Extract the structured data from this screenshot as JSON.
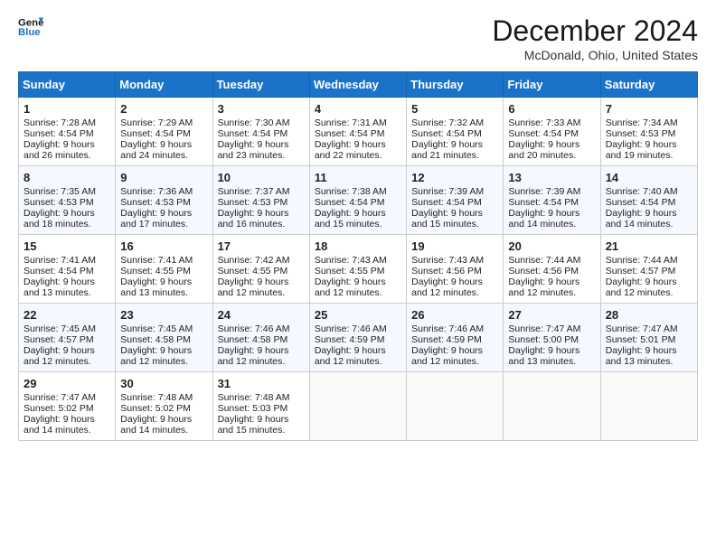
{
  "header": {
    "logo_line1": "General",
    "logo_line2": "Blue",
    "month": "December 2024",
    "location": "McDonald, Ohio, United States"
  },
  "weekdays": [
    "Sunday",
    "Monday",
    "Tuesday",
    "Wednesday",
    "Thursday",
    "Friday",
    "Saturday"
  ],
  "weeks": [
    [
      {
        "day": "1",
        "lines": [
          "Sunrise: 7:28 AM",
          "Sunset: 4:54 PM",
          "Daylight: 9 hours",
          "and 26 minutes."
        ]
      },
      {
        "day": "2",
        "lines": [
          "Sunrise: 7:29 AM",
          "Sunset: 4:54 PM",
          "Daylight: 9 hours",
          "and 24 minutes."
        ]
      },
      {
        "day": "3",
        "lines": [
          "Sunrise: 7:30 AM",
          "Sunset: 4:54 PM",
          "Daylight: 9 hours",
          "and 23 minutes."
        ]
      },
      {
        "day": "4",
        "lines": [
          "Sunrise: 7:31 AM",
          "Sunset: 4:54 PM",
          "Daylight: 9 hours",
          "and 22 minutes."
        ]
      },
      {
        "day": "5",
        "lines": [
          "Sunrise: 7:32 AM",
          "Sunset: 4:54 PM",
          "Daylight: 9 hours",
          "and 21 minutes."
        ]
      },
      {
        "day": "6",
        "lines": [
          "Sunrise: 7:33 AM",
          "Sunset: 4:54 PM",
          "Daylight: 9 hours",
          "and 20 minutes."
        ]
      },
      {
        "day": "7",
        "lines": [
          "Sunrise: 7:34 AM",
          "Sunset: 4:53 PM",
          "Daylight: 9 hours",
          "and 19 minutes."
        ]
      }
    ],
    [
      {
        "day": "8",
        "lines": [
          "Sunrise: 7:35 AM",
          "Sunset: 4:53 PM",
          "Daylight: 9 hours",
          "and 18 minutes."
        ]
      },
      {
        "day": "9",
        "lines": [
          "Sunrise: 7:36 AM",
          "Sunset: 4:53 PM",
          "Daylight: 9 hours",
          "and 17 minutes."
        ]
      },
      {
        "day": "10",
        "lines": [
          "Sunrise: 7:37 AM",
          "Sunset: 4:53 PM",
          "Daylight: 9 hours",
          "and 16 minutes."
        ]
      },
      {
        "day": "11",
        "lines": [
          "Sunrise: 7:38 AM",
          "Sunset: 4:54 PM",
          "Daylight: 9 hours",
          "and 15 minutes."
        ]
      },
      {
        "day": "12",
        "lines": [
          "Sunrise: 7:39 AM",
          "Sunset: 4:54 PM",
          "Daylight: 9 hours",
          "and 15 minutes."
        ]
      },
      {
        "day": "13",
        "lines": [
          "Sunrise: 7:39 AM",
          "Sunset: 4:54 PM",
          "Daylight: 9 hours",
          "and 14 minutes."
        ]
      },
      {
        "day": "14",
        "lines": [
          "Sunrise: 7:40 AM",
          "Sunset: 4:54 PM",
          "Daylight: 9 hours",
          "and 14 minutes."
        ]
      }
    ],
    [
      {
        "day": "15",
        "lines": [
          "Sunrise: 7:41 AM",
          "Sunset: 4:54 PM",
          "Daylight: 9 hours",
          "and 13 minutes."
        ]
      },
      {
        "day": "16",
        "lines": [
          "Sunrise: 7:41 AM",
          "Sunset: 4:55 PM",
          "Daylight: 9 hours",
          "and 13 minutes."
        ]
      },
      {
        "day": "17",
        "lines": [
          "Sunrise: 7:42 AM",
          "Sunset: 4:55 PM",
          "Daylight: 9 hours",
          "and 12 minutes."
        ]
      },
      {
        "day": "18",
        "lines": [
          "Sunrise: 7:43 AM",
          "Sunset: 4:55 PM",
          "Daylight: 9 hours",
          "and 12 minutes."
        ]
      },
      {
        "day": "19",
        "lines": [
          "Sunrise: 7:43 AM",
          "Sunset: 4:56 PM",
          "Daylight: 9 hours",
          "and 12 minutes."
        ]
      },
      {
        "day": "20",
        "lines": [
          "Sunrise: 7:44 AM",
          "Sunset: 4:56 PM",
          "Daylight: 9 hours",
          "and 12 minutes."
        ]
      },
      {
        "day": "21",
        "lines": [
          "Sunrise: 7:44 AM",
          "Sunset: 4:57 PM",
          "Daylight: 9 hours",
          "and 12 minutes."
        ]
      }
    ],
    [
      {
        "day": "22",
        "lines": [
          "Sunrise: 7:45 AM",
          "Sunset: 4:57 PM",
          "Daylight: 9 hours",
          "and 12 minutes."
        ]
      },
      {
        "day": "23",
        "lines": [
          "Sunrise: 7:45 AM",
          "Sunset: 4:58 PM",
          "Daylight: 9 hours",
          "and 12 minutes."
        ]
      },
      {
        "day": "24",
        "lines": [
          "Sunrise: 7:46 AM",
          "Sunset: 4:58 PM",
          "Daylight: 9 hours",
          "and 12 minutes."
        ]
      },
      {
        "day": "25",
        "lines": [
          "Sunrise: 7:46 AM",
          "Sunset: 4:59 PM",
          "Daylight: 9 hours",
          "and 12 minutes."
        ]
      },
      {
        "day": "26",
        "lines": [
          "Sunrise: 7:46 AM",
          "Sunset: 4:59 PM",
          "Daylight: 9 hours",
          "and 12 minutes."
        ]
      },
      {
        "day": "27",
        "lines": [
          "Sunrise: 7:47 AM",
          "Sunset: 5:00 PM",
          "Daylight: 9 hours",
          "and 13 minutes."
        ]
      },
      {
        "day": "28",
        "lines": [
          "Sunrise: 7:47 AM",
          "Sunset: 5:01 PM",
          "Daylight: 9 hours",
          "and 13 minutes."
        ]
      }
    ],
    [
      {
        "day": "29",
        "lines": [
          "Sunrise: 7:47 AM",
          "Sunset: 5:02 PM",
          "Daylight: 9 hours",
          "and 14 minutes."
        ]
      },
      {
        "day": "30",
        "lines": [
          "Sunrise: 7:48 AM",
          "Sunset: 5:02 PM",
          "Daylight: 9 hours",
          "and 14 minutes."
        ]
      },
      {
        "day": "31",
        "lines": [
          "Sunrise: 7:48 AM",
          "Sunset: 5:03 PM",
          "Daylight: 9 hours",
          "and 15 minutes."
        ]
      },
      null,
      null,
      null,
      null
    ]
  ]
}
